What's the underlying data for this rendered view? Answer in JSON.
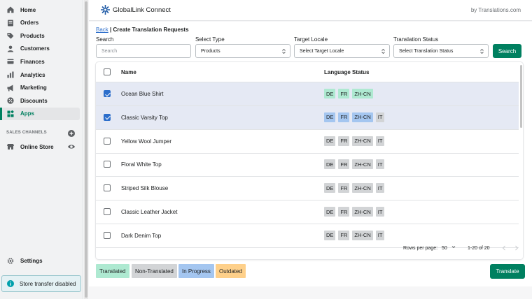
{
  "sidebar": {
    "items": [
      {
        "label": "Home",
        "icon": "home-icon"
      },
      {
        "label": "Orders",
        "icon": "orders-icon"
      },
      {
        "label": "Products",
        "icon": "tag-icon"
      },
      {
        "label": "Customers",
        "icon": "person-icon"
      },
      {
        "label": "Finances",
        "icon": "finances-icon"
      },
      {
        "label": "Analytics",
        "icon": "bar-chart-icon"
      },
      {
        "label": "Marketing",
        "icon": "megaphone-icon"
      },
      {
        "label": "Discounts",
        "icon": "discount-icon"
      },
      {
        "label": "Apps",
        "icon": "apps-icon",
        "active": true
      }
    ],
    "sales_channels_title": "SALES CHANNELS",
    "online_store": "Online Store",
    "settings": "Settings",
    "store_transfer": "Store transfer disabled"
  },
  "header": {
    "brand": "GlobalLink Connect",
    "byline": "by Translations.com"
  },
  "breadcrumb": {
    "back": "Back",
    "title": "| Create Translation Requests"
  },
  "filters": {
    "search_label": "Search",
    "search_placeholder": "Search",
    "type_label": "Select Type",
    "type_value": "Products",
    "locale_label": "Target Locale",
    "locale_value": "Select Target Locale",
    "status_label": "Translation Status",
    "status_value": "Select Translation Status",
    "search_button": "Search"
  },
  "table": {
    "col_name": "Name",
    "col_status": "Language Status",
    "rows": [
      {
        "name": "Ocean Blue Shirt",
        "selected": true,
        "locales": [
          {
            "code": "DE",
            "status": "translated"
          },
          {
            "code": "FR",
            "status": "translated"
          },
          {
            "code": "ZH-CN",
            "status": "translated"
          }
        ]
      },
      {
        "name": "Classic Varsity Top",
        "selected": true,
        "locales": [
          {
            "code": "DE",
            "status": "in_progress"
          },
          {
            "code": "FR",
            "status": "in_progress"
          },
          {
            "code": "ZH-CN",
            "status": "in_progress"
          },
          {
            "code": "IT",
            "status": "non_translated"
          }
        ]
      },
      {
        "name": "Yellow Wool Jumper",
        "selected": false,
        "locales": [
          {
            "code": "DE",
            "status": "non_translated"
          },
          {
            "code": "FR",
            "status": "non_translated"
          },
          {
            "code": "ZH-CN",
            "status": "non_translated"
          },
          {
            "code": "IT",
            "status": "non_translated"
          }
        ]
      },
      {
        "name": "Floral White Top",
        "selected": false,
        "locales": [
          {
            "code": "DE",
            "status": "non_translated"
          },
          {
            "code": "FR",
            "status": "non_translated"
          },
          {
            "code": "ZH-CN",
            "status": "non_translated"
          },
          {
            "code": "IT",
            "status": "non_translated"
          }
        ]
      },
      {
        "name": "Striped Silk Blouse",
        "selected": false,
        "locales": [
          {
            "code": "DE",
            "status": "non_translated"
          },
          {
            "code": "FR",
            "status": "non_translated"
          },
          {
            "code": "ZH-CN",
            "status": "non_translated"
          },
          {
            "code": "IT",
            "status": "non_translated"
          }
        ]
      },
      {
        "name": "Classic Leather Jacket",
        "selected": false,
        "locales": [
          {
            "code": "DE",
            "status": "non_translated"
          },
          {
            "code": "FR",
            "status": "non_translated"
          },
          {
            "code": "ZH-CN",
            "status": "non_translated"
          },
          {
            "code": "IT",
            "status": "non_translated"
          }
        ]
      },
      {
        "name": "Dark Denim Top",
        "selected": false,
        "locales": [
          {
            "code": "DE",
            "status": "non_translated"
          },
          {
            "code": "FR",
            "status": "non_translated"
          },
          {
            "code": "ZH-CN",
            "status": "non_translated"
          },
          {
            "code": "IT",
            "status": "non_translated"
          }
        ]
      }
    ],
    "rows_per_page_label": "Rows per page:",
    "rows_per_page_value": "50",
    "range": "1-20 of 20"
  },
  "legend": {
    "translated": "Translated",
    "non_translated": "Non-Translated",
    "in_progress": "In Progress",
    "outdated": "Outdated"
  },
  "translate_button": "Translate",
  "colors": {
    "translated": "#aee9d1",
    "non_translated": "#d2d4d6",
    "in_progress": "#a4c6f0",
    "outdated": "#fed08a",
    "primary": "#008060",
    "link": "#2c6ecb"
  }
}
